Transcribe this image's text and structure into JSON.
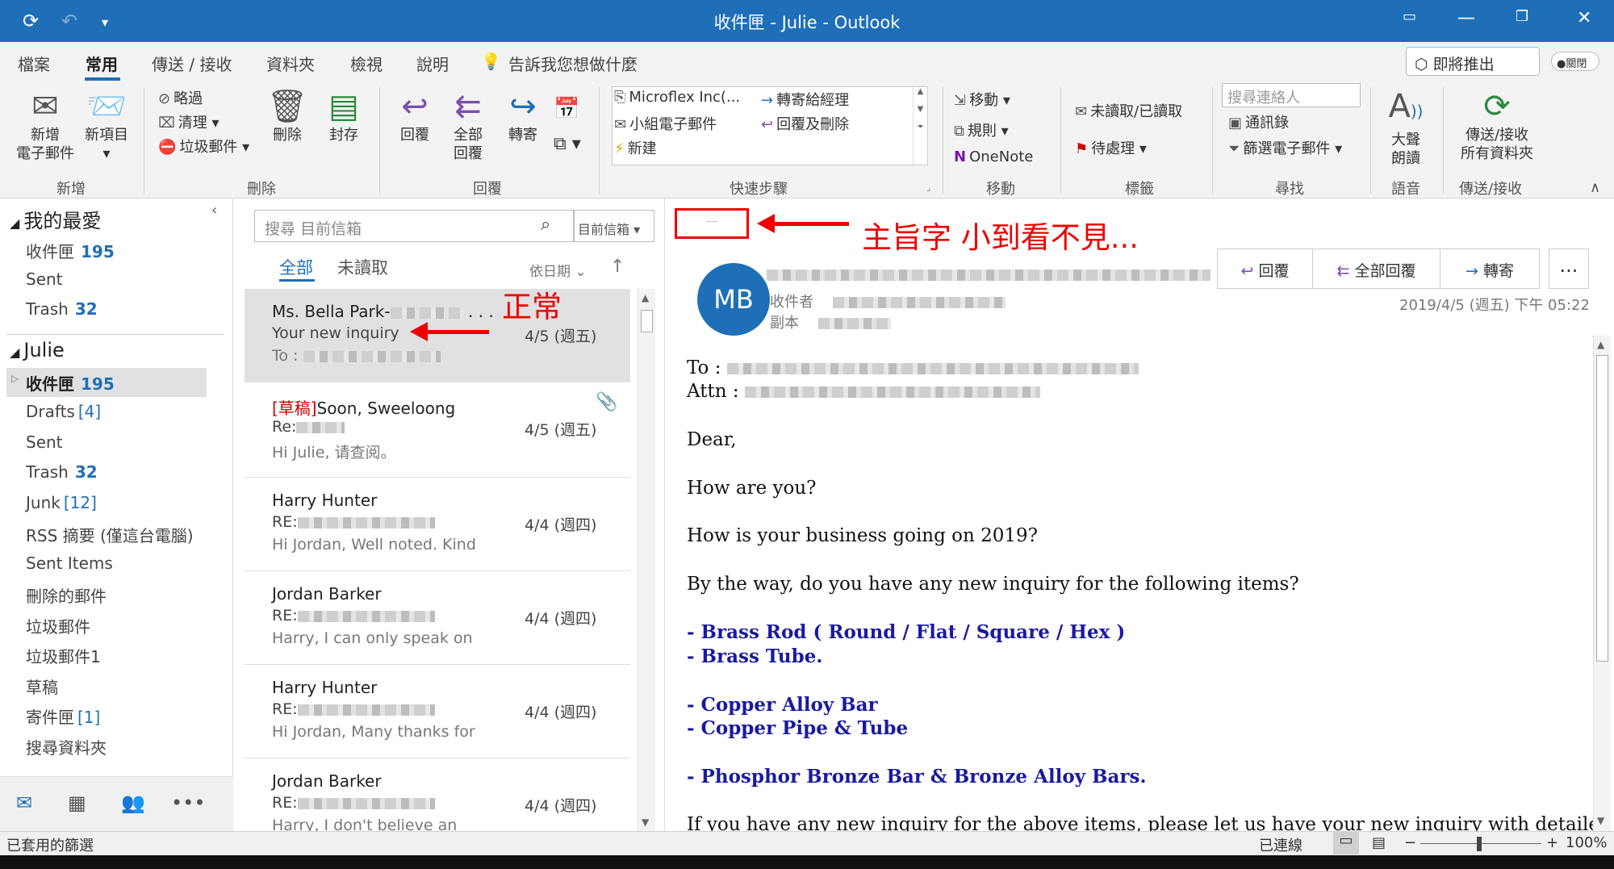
{
  "title": "收件匣 - Julie - Outlook",
  "menu": {
    "tabs": [
      "檔案",
      "常用",
      "傳送 / 接收",
      "資料夾",
      "檢視",
      "說明"
    ],
    "tellme": "告訴我您想做什麼",
    "coming_soon": "即將推出",
    "toggle": "關閉"
  },
  "ribbon": {
    "new_email": "新增\n電子郵件",
    "new_items": "新項目",
    "ignore": "略過",
    "cleanup": "清理",
    "junk": "垃圾郵件",
    "delete": "刪除",
    "archive": "封存",
    "reply": "回覆",
    "reply_all": "全部\n回覆",
    "forward": "轉寄",
    "quick_steps": [
      "Microflex Inc(...",
      "小組電子郵件",
      "新建",
      "轉寄給經理",
      "回覆及刪除"
    ],
    "move": "移動",
    "rules": "規則",
    "onenote": "OneNote",
    "unread_read": "未讀取/已讀取",
    "followup": "待處理",
    "search_people": "搜尋連絡人",
    "address_book": "通訊錄",
    "filter_email": "篩選電子郵件",
    "read_aloud": "大聲\n朗讀",
    "send_receive_all": "傳送/接收\n所有資料夾",
    "groups": [
      "新增",
      "刪除",
      "回覆",
      "快速步驟",
      "移動",
      "標籤",
      "尋找",
      "語音",
      "傳送/接收"
    ]
  },
  "folders": {
    "favorites_header": "我的最愛",
    "favorites": [
      {
        "name": "收件匣",
        "count": "195"
      },
      {
        "name": "Sent",
        "count": ""
      },
      {
        "name": "Trash",
        "count": "32"
      }
    ],
    "account_header": "Julie",
    "account_items": [
      {
        "name": "收件匣",
        "count": "195",
        "bracket": ""
      },
      {
        "name": "Drafts",
        "count": "",
        "bracket": "[4]"
      },
      {
        "name": "Sent",
        "count": "",
        "bracket": ""
      },
      {
        "name": "Trash",
        "count": "32",
        "bracket": ""
      },
      {
        "name": "Junk",
        "count": "",
        "bracket": "[12]"
      },
      {
        "name": "RSS 摘要 (僅這台電腦)",
        "count": "",
        "bracket": ""
      },
      {
        "name": "Sent Items",
        "count": "",
        "bracket": ""
      },
      {
        "name": "刪除的郵件",
        "count": "",
        "bracket": ""
      },
      {
        "name": "垃圾郵件",
        "count": "",
        "bracket": ""
      },
      {
        "name": "垃圾郵件1",
        "count": "",
        "bracket": ""
      },
      {
        "name": "草稿",
        "count": "",
        "bracket": ""
      },
      {
        "name": "寄件匣",
        "count": "",
        "bracket": "[1]"
      },
      {
        "name": "搜尋資料夾",
        "count": "",
        "bracket": ""
      }
    ]
  },
  "list": {
    "search_placeholder": "搜尋 目前信箱",
    "scope": "目前信箱",
    "filter_all": "全部",
    "filter_unread": "未讀取",
    "sort": "依日期",
    "messages": [
      {
        "from": "Ms. Bella Park-",
        "subject": "Your new inquiry",
        "preview": "To :",
        "date": "4/5 (週五)",
        "draft": ""
      },
      {
        "from": "Soon, Sweeloong",
        "subject": "Re:",
        "preview": "Hi Julie, 请查阅。",
        "date": "4/5 (週五)",
        "draft": "[草稿]"
      },
      {
        "from": "Harry Hunter",
        "subject": "RE:",
        "preview": "Hi Jordan,  Well noted.  Kind",
        "date": "4/4 (週四)",
        "draft": ""
      },
      {
        "from": "Jordan Barker",
        "subject": "RE:",
        "preview": "Harry,  I can only speak on",
        "date": "4/4 (週四)",
        "draft": ""
      },
      {
        "from": "Harry Hunter",
        "subject": "RE:",
        "preview": "Hi Jordan,  Many thanks for",
        "date": "4/4 (週四)",
        "draft": ""
      },
      {
        "from": "Jordan Barker",
        "subject": "RE:",
        "preview": "Harry,  I don't believe an",
        "date": "4/4 (週四)",
        "draft": ""
      }
    ]
  },
  "annotations": {
    "normal": "正常",
    "subject_tiny": "主旨字 小到看不見..."
  },
  "reading": {
    "avatar": "MB",
    "to_label": "收件者",
    "cc_label": "副本",
    "date": "2019/4/5 (週五) 下午 05:22",
    "reply": "回覆",
    "reply_all": "全部回覆",
    "forward": "轉寄",
    "more": "...",
    "body": {
      "to": "To :",
      "attn": "Attn :",
      "dear": "Dear,",
      "line1": "How are you?",
      "line2": "How is your business going on 2019?",
      "line3": "By the way, do you have any new inquiry for the following items?",
      "items": [
        "- Brass Rod ( Round / Flat / Square / Hex )",
        "- Brass Tube.",
        "- Copper Alloy Bar",
        "- Copper Pipe & Tube",
        "- Phosphor Bronze Bar & Bronze Alloy Bars."
      ],
      "last": "If you have any new inquiry for the above items, please let us have your new inquiry with detailed size and"
    }
  },
  "status": {
    "filter_applied": "已套用的篩選",
    "connected": "已連線",
    "zoom": "100%"
  }
}
